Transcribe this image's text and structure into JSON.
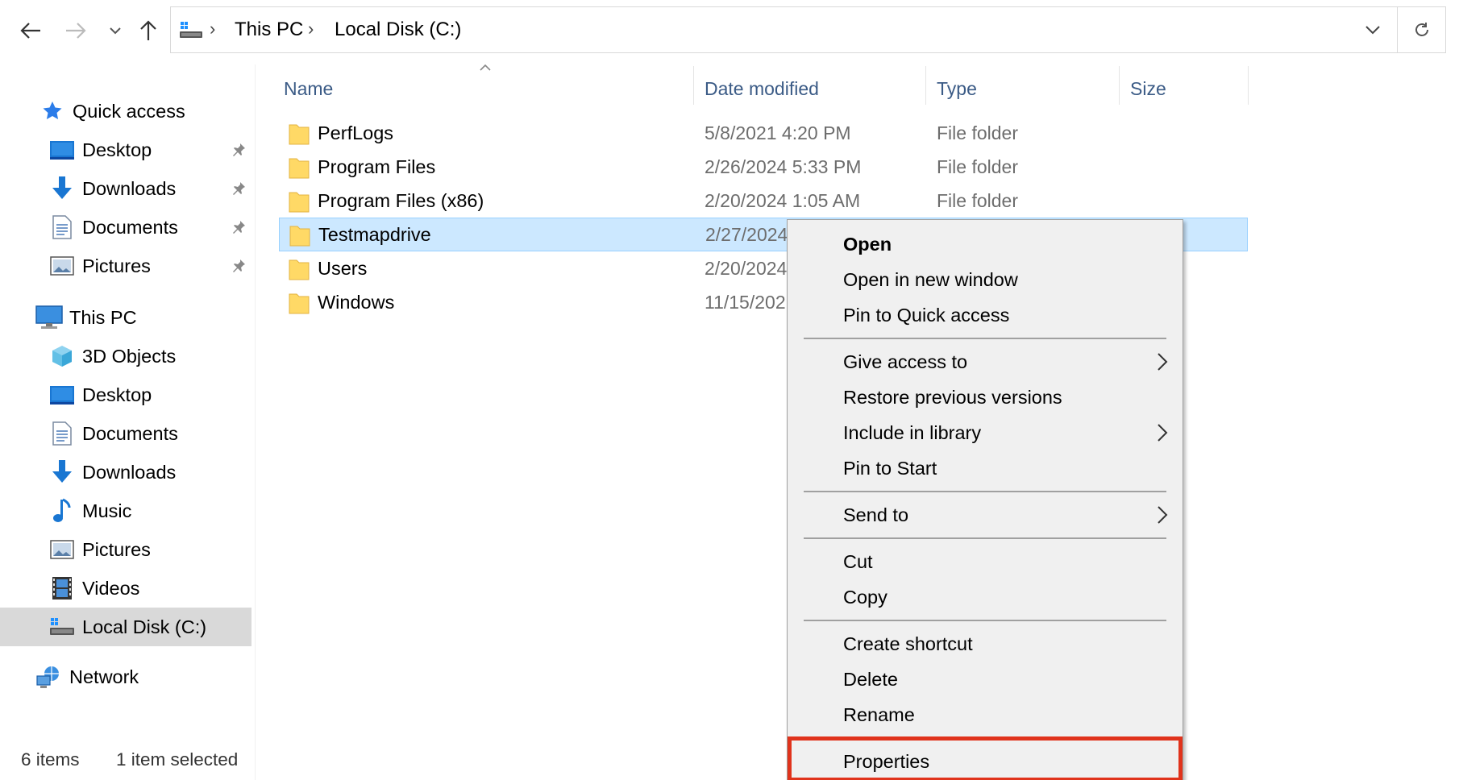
{
  "address_bar": {
    "breadcrumbs": [
      "This PC",
      "Local Disk (C:)"
    ],
    "drive_icon": "drive-icon"
  },
  "navigation": {
    "quick_access": "Quick access",
    "quick_items": [
      {
        "label": "Desktop",
        "icon": "desktop-icon",
        "pinned": true
      },
      {
        "label": "Downloads",
        "icon": "download-icon",
        "pinned": true
      },
      {
        "label": "Documents",
        "icon": "document-icon",
        "pinned": true
      },
      {
        "label": "Pictures",
        "icon": "pictures-icon",
        "pinned": true
      }
    ],
    "this_pc": "This PC",
    "pc_items": [
      {
        "label": "3D Objects",
        "icon": "3d-objects-icon"
      },
      {
        "label": "Desktop",
        "icon": "desktop-icon"
      },
      {
        "label": "Documents",
        "icon": "document-icon"
      },
      {
        "label": "Downloads",
        "icon": "download-icon"
      },
      {
        "label": "Music",
        "icon": "music-icon"
      },
      {
        "label": "Pictures",
        "icon": "pictures-icon"
      },
      {
        "label": "Videos",
        "icon": "videos-icon"
      },
      {
        "label": "Local Disk (C:)",
        "icon": "drive-icon",
        "selected": true
      }
    ],
    "network": "Network"
  },
  "columns": {
    "name": "Name",
    "date": "Date modified",
    "type": "Type",
    "size": "Size"
  },
  "files": [
    {
      "name": "PerfLogs",
      "date": "5/8/2021 4:20 PM",
      "type": "File folder"
    },
    {
      "name": "Program Files",
      "date": "2/26/2024 5:33 PM",
      "type": "File folder"
    },
    {
      "name": "Program Files (x86)",
      "date": "2/20/2024 1:05 AM",
      "type": "File folder"
    },
    {
      "name": "Testmapdrive",
      "date": "2/27/2024",
      "type": "",
      "selected": true
    },
    {
      "name": "Users",
      "date": "2/20/2024",
      "type": ""
    },
    {
      "name": "Windows",
      "date": "11/15/202",
      "type": ""
    }
  ],
  "status": {
    "count": "6 items",
    "selection": "1 item selected"
  },
  "context_menu": {
    "items": [
      {
        "label": "Open",
        "bold": true
      },
      {
        "label": "Open in new window"
      },
      {
        "label": "Pin to Quick access"
      },
      {
        "separator": true
      },
      {
        "label": "Give access to",
        "submenu": true
      },
      {
        "label": "Restore previous versions"
      },
      {
        "label": "Include in library",
        "submenu": true
      },
      {
        "label": "Pin to Start"
      },
      {
        "separator": true
      },
      {
        "label": "Send to",
        "submenu": true
      },
      {
        "separator": true
      },
      {
        "label": "Cut"
      },
      {
        "label": "Copy"
      },
      {
        "separator": true
      },
      {
        "label": "Create shortcut"
      },
      {
        "label": "Delete"
      },
      {
        "label": "Rename"
      },
      {
        "separator": true
      },
      {
        "label": "Properties",
        "highlighted": true
      }
    ]
  },
  "colors": {
    "selection_bg": "#cce8ff",
    "selection_border": "#99d1ff",
    "highlight_border": "#e0331c",
    "header_text": "#3b5b86",
    "folder_yellow": "#ffd966"
  }
}
